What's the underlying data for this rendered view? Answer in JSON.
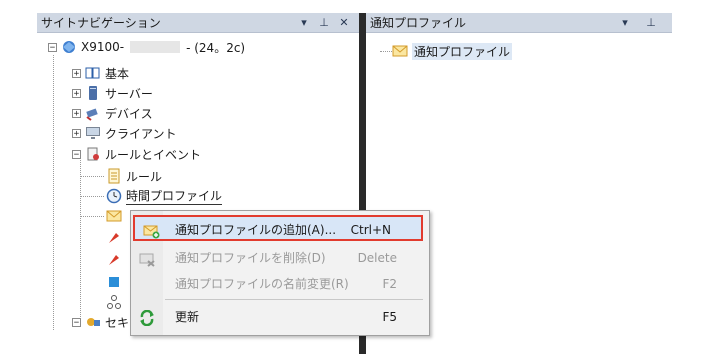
{
  "left_pane": {
    "title": "サイトナビゲーション",
    "controls": [
      "▾",
      "⊥",
      "✕"
    ]
  },
  "right_pane": {
    "title": "通知プロファイル",
    "controls": [
      "▾",
      "⊥"
    ],
    "items": [
      "通知プロファイル"
    ]
  },
  "tree": {
    "root": {
      "label": "X9100-",
      "suffix": "- (24。2c)"
    },
    "items": [
      {
        "label": "基本",
        "icon": "book-icon"
      },
      {
        "label": "サーバー",
        "icon": "server-icon"
      },
      {
        "label": "デバイス",
        "icon": "camera-icon"
      },
      {
        "label": "クライアント",
        "icon": "monitor-icon"
      },
      {
        "label": "ルールとイベント",
        "icon": "rules-icon"
      },
      {
        "label": "ルール",
        "icon": "list-icon"
      },
      {
        "label": "時間プロファイル",
        "icon": "clock-icon"
      },
      {
        "label": "セキ",
        "icon": "security-icon"
      }
    ]
  },
  "context_menu": {
    "items": [
      {
        "label": "通知プロファイルの追加(A)...",
        "shortcut": "Ctrl+N",
        "icon": "add-mail-icon",
        "enabled": true,
        "highlighted": true
      },
      {
        "label": "通知プロファイルを削除(D)",
        "shortcut": "Delete",
        "icon": "delete-mail-icon",
        "enabled": false
      },
      {
        "label": "通知プロファイルの名前変更(R)",
        "shortcut": "F2",
        "icon": "",
        "enabled": false
      },
      {
        "label": "更新",
        "shortcut": "F5",
        "icon": "refresh-icon",
        "enabled": true
      }
    ]
  },
  "colors": {
    "highlight_border": "#e23b2e",
    "header_bg": "#cfd7e3",
    "selection": "#d8e6f7"
  }
}
